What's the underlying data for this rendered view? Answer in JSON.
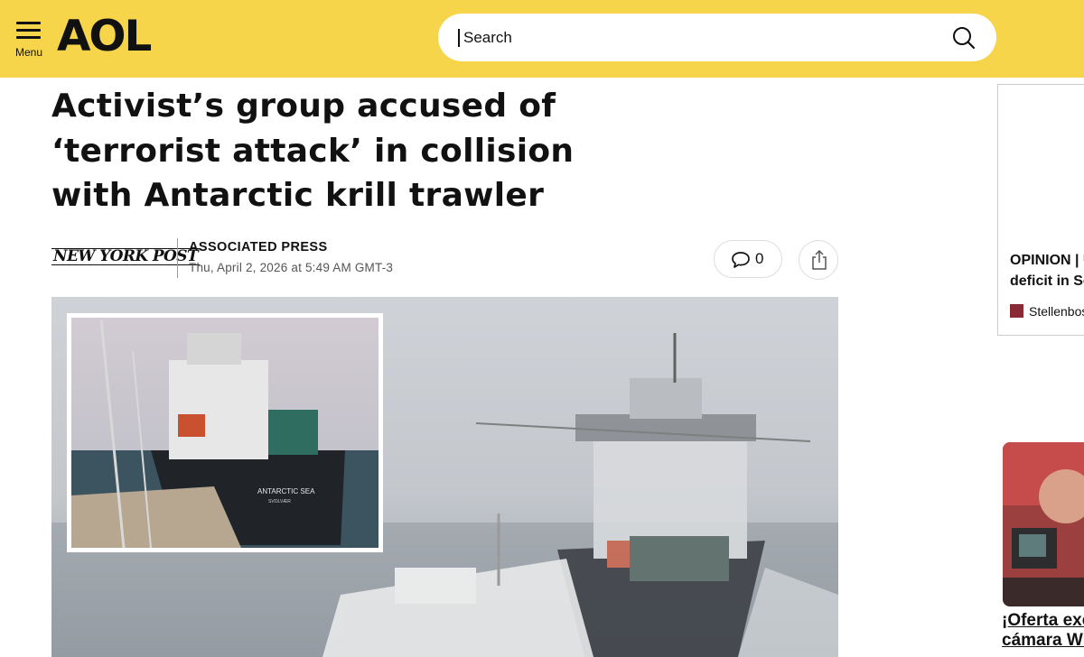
{
  "header": {
    "menu_label": "Menu",
    "logo_text": "AOL",
    "search_placeholder": "Search",
    "brand_color": "#f7d54a",
    "icons": [
      "menu-icon",
      "search-icon"
    ]
  },
  "article": {
    "headline": "Activist’s group accused of ‘terrorist attack’ in collision with Antarctic krill trawler",
    "publisher_logo": "NEW YORK POST",
    "author": "ASSOCIATED PRESS",
    "date": "Thu, April 2, 2026 at 5:49 AM GMT-3",
    "comment_count": "0",
    "icons": [
      "comment-icon",
      "share-icon"
    ],
    "image_ship_name": "ANTARCTIC SEA",
    "image_ship_port": "SVOLVÆR"
  },
  "sidebar": {
    "ad_title_line1": "OPINION | U",
    "ad_title_line2": "deficit in So",
    "ad_source": "Stellenbos",
    "promo_line1": "¡Oferta exc",
    "promo_line2": "cámara Wi"
  }
}
